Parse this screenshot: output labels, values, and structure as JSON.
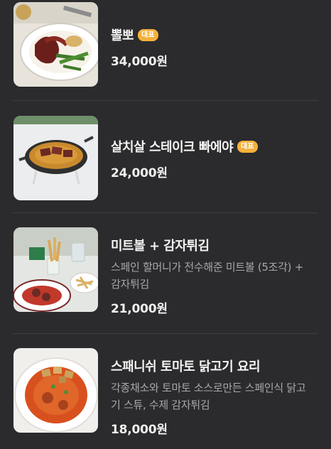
{
  "menu": {
    "items": [
      {
        "name": "뽈뽀",
        "badge": "대표",
        "description": "",
        "price": "34,000원"
      },
      {
        "name": "살치살 스테이크 빠에야",
        "badge": "대표",
        "description": "",
        "price": "24,000원"
      },
      {
        "name": "미트볼 + 감자튀김",
        "badge": "",
        "description": "스페인 할머니가 전수해준 미트볼 (5조각) + 감자튀김",
        "price": "21,000원"
      },
      {
        "name": "스패니쉬 토마토 닭고기 요리",
        "badge": "",
        "description": "각종채소와 토마토 소스로만든 스페인식 닭고기 스튜, 수제 감자튀김",
        "price": "18,000원"
      }
    ]
  },
  "colors": {
    "background": "#2b2b2d",
    "badge": "#f4b13c",
    "description": "#a8a8ab",
    "divider": "#3d3d40"
  }
}
